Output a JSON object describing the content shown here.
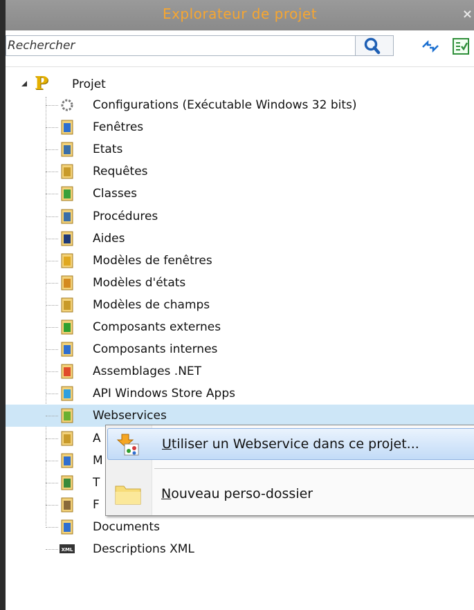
{
  "window": {
    "title": "Explorateur de projet",
    "close_label": "×"
  },
  "toolbar": {
    "search_placeholder": "Rechercher",
    "search_value": "",
    "icons": [
      "search-icon",
      "sync-icon",
      "checklist-icon"
    ]
  },
  "tree": {
    "root_label": "Projet",
    "root_icon": "project-p-icon",
    "items": [
      {
        "label": "Configurations (Exécutable Windows 32 bits)",
        "icon": "configuration-icon",
        "expandable": true
      },
      {
        "label": "Fenêtres",
        "icon": "windows-icon",
        "expandable": true
      },
      {
        "label": "Etats",
        "icon": "reports-icon",
        "expandable": false
      },
      {
        "label": "Requêtes",
        "icon": "queries-icon",
        "expandable": false
      },
      {
        "label": "Classes",
        "icon": "classes-icon",
        "expandable": false
      },
      {
        "label": "Procédures",
        "icon": "procedures-icon",
        "expandable": false
      },
      {
        "label": "Aides",
        "icon": "help-icon",
        "expandable": false
      },
      {
        "label": "Modèles de fenêtres",
        "icon": "window-templates-icon",
        "expandable": false
      },
      {
        "label": "Modèles d'états",
        "icon": "report-templates-icon",
        "expandable": false
      },
      {
        "label": "Modèles de champs",
        "icon": "control-templates-icon",
        "expandable": false
      },
      {
        "label": "Composants externes",
        "icon": "external-components-icon",
        "expandable": false
      },
      {
        "label": "Composants internes",
        "icon": "internal-components-icon",
        "expandable": false
      },
      {
        "label": "Assemblages .NET",
        "icon": "dotnet-assemblies-icon",
        "expandable": false
      },
      {
        "label": "API Windows Store Apps",
        "icon": "windows-store-api-icon",
        "expandable": false
      },
      {
        "label": "Webservices",
        "icon": "webservices-icon",
        "expandable": false,
        "selected": true
      },
      {
        "label": "A",
        "icon": "partially-hidden-icon-1",
        "expandable": false
      },
      {
        "label": "M",
        "icon": "partially-hidden-icon-2",
        "expandable": false
      },
      {
        "label": "T",
        "icon": "partially-hidden-icon-3",
        "expandable": false
      },
      {
        "label": "F",
        "icon": "partially-hidden-icon-4",
        "expandable": false
      },
      {
        "label": "Documents",
        "icon": "documents-icon",
        "expandable": true
      },
      {
        "label": "Descriptions XML",
        "icon": "xml-icon",
        "expandable": false
      }
    ]
  },
  "context_menu": {
    "items": [
      {
        "label": "Utiliser un Webservice dans ce projet...",
        "accel": "U",
        "rest": "tiliser un Webservice dans ce projet...",
        "icon": "import-webservice-icon",
        "highlighted": true
      },
      {
        "label": "Nouveau perso-dossier",
        "accel": "N",
        "rest": "ouveau perso-dossier",
        "icon": "folder-icon",
        "highlighted": false
      }
    ]
  },
  "colors": {
    "title_text": "#f7a630",
    "title_bg": "#8f8f8f",
    "selection": "#cde6f7",
    "menu_highlight": "#c2dbf7"
  }
}
